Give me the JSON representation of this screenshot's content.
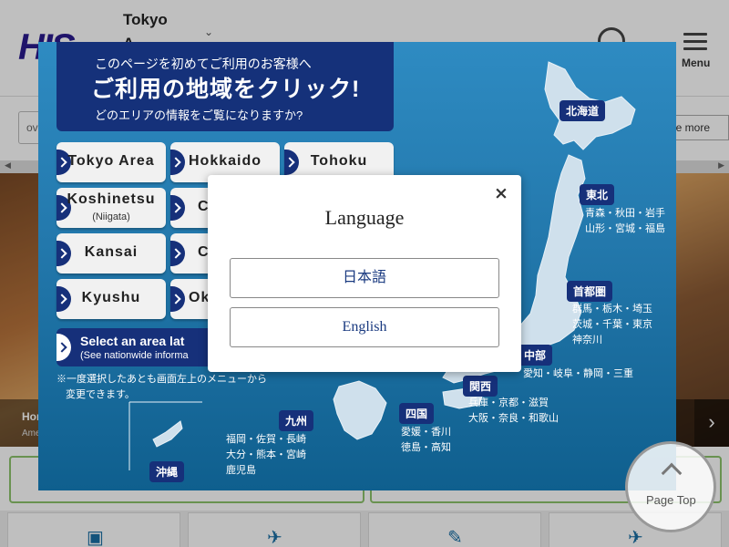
{
  "header": {
    "logo": "HIS",
    "region_line1": "Tokyo",
    "region_line2": "A",
    "menu_label": "Menu"
  },
  "search": {
    "value": "ov"
  },
  "see_more": "ee more",
  "hero": {
    "caption_title": "Hor",
    "caption_sub": "Ame"
  },
  "page_top": "Page Top",
  "region_overlay": {
    "intro_line1": "このページを初めてご利用のお客様へ",
    "intro_line2": "ご利用の地域をクリック!",
    "intro_line3": "どのエリアの情報をご覧になりますか?",
    "areas": [
      {
        "label": "Tokyo Area"
      },
      {
        "label": "Hokkaido"
      },
      {
        "label": "Tohoku"
      },
      {
        "label": "Koshinetsu",
        "sub": "(Niigata)"
      },
      {
        "label": "C"
      },
      {
        "label": "Kansai"
      },
      {
        "label": "C"
      },
      {
        "label": "Kyushu"
      },
      {
        "label": "Ok"
      }
    ],
    "later_title": "Select an area lat",
    "later_sub": "(See nationwide informa",
    "note_line1": "※一度選択したあとも画面左上のメニューから",
    "note_line2": "変更できます。",
    "regions": {
      "hokkaido": "北海道",
      "tohoku": "東北",
      "tohoku_prefs1": "青森・秋田・岩手",
      "tohoku_prefs2": "山形・宮城・福島",
      "shutoken": "首都圏",
      "shutoken_prefs1": "群馬・栃木・埼玉",
      "shutoken_prefs2": "茨城・千葉・東京",
      "shutoken_prefs3": "神奈川",
      "chubu": "中部",
      "chubu_prefs": "愛知・岐阜・静岡・三重",
      "kansai": "関西",
      "kansai_prefs1": "兵庫・京都・滋賀",
      "kansai_prefs2": "大阪・奈良・和歌山",
      "shikoku": "四国",
      "shikoku_prefs1": "愛媛・香川",
      "shikoku_prefs2": "徳島・高知",
      "kyushu": "九州",
      "kyushu_prefs1": "福岡・佐賀・長崎",
      "kyushu_prefs2": "大分・熊本・宮崎",
      "kyushu_prefs3": "鹿児島",
      "okinawa": "沖縄"
    }
  },
  "language_modal": {
    "title": "Language",
    "close": "×",
    "options": [
      "日本語",
      "English"
    ]
  },
  "colors": {
    "panel_blue": "#2378ac",
    "navy": "#16307a",
    "map_land": "#cfe0ec",
    "link_blue": "#1a3a80"
  }
}
